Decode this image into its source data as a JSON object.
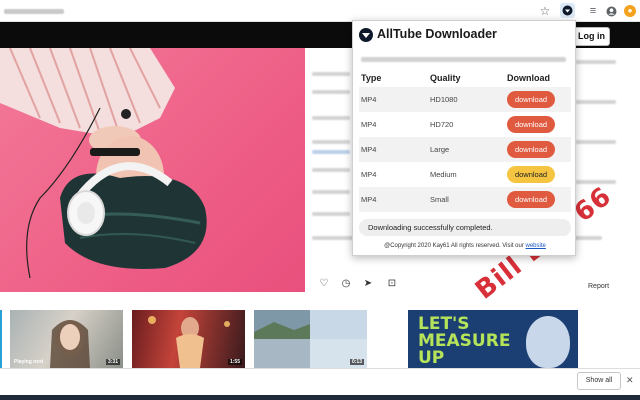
{
  "browser": {
    "icons": [
      "star-icon",
      "alltube-extension-icon",
      "playlist-icon",
      "account-icon",
      "menu-icon"
    ]
  },
  "site": {
    "login_label": "Log in",
    "report_label": "Report",
    "thumbnails": [
      {
        "caption": "Playing next",
        "duration": "3:31"
      },
      {
        "caption": "",
        "duration": "1:55"
      },
      {
        "caption": "",
        "duration": "0:13"
      }
    ],
    "promo_text": "LET'S\nMEASURE\nUP",
    "watermark": "Bill Lee 66",
    "show_all_label": "Show all"
  },
  "popup": {
    "title": "AllTube Downloader",
    "columns": [
      "Type",
      "Quality",
      "Download"
    ],
    "rows": [
      {
        "type": "MP4",
        "quality": "HD1080",
        "action": "download",
        "active": false
      },
      {
        "type": "MP4",
        "quality": "HD720",
        "action": "download",
        "active": false
      },
      {
        "type": "MP4",
        "quality": "Large",
        "action": "download",
        "active": false
      },
      {
        "type": "MP4",
        "quality": "Medium",
        "action": "download",
        "active": true
      },
      {
        "type": "MP4",
        "quality": "Small",
        "action": "download",
        "active": false
      }
    ],
    "status": "Downloading successfully completed.",
    "copyright": "@Copyright 2020 Kay61 All rights reserved. Visit our",
    "copyright_link": "website",
    "colors": {
      "download_button": "#e05a40",
      "active_button": "#f5c542"
    }
  }
}
